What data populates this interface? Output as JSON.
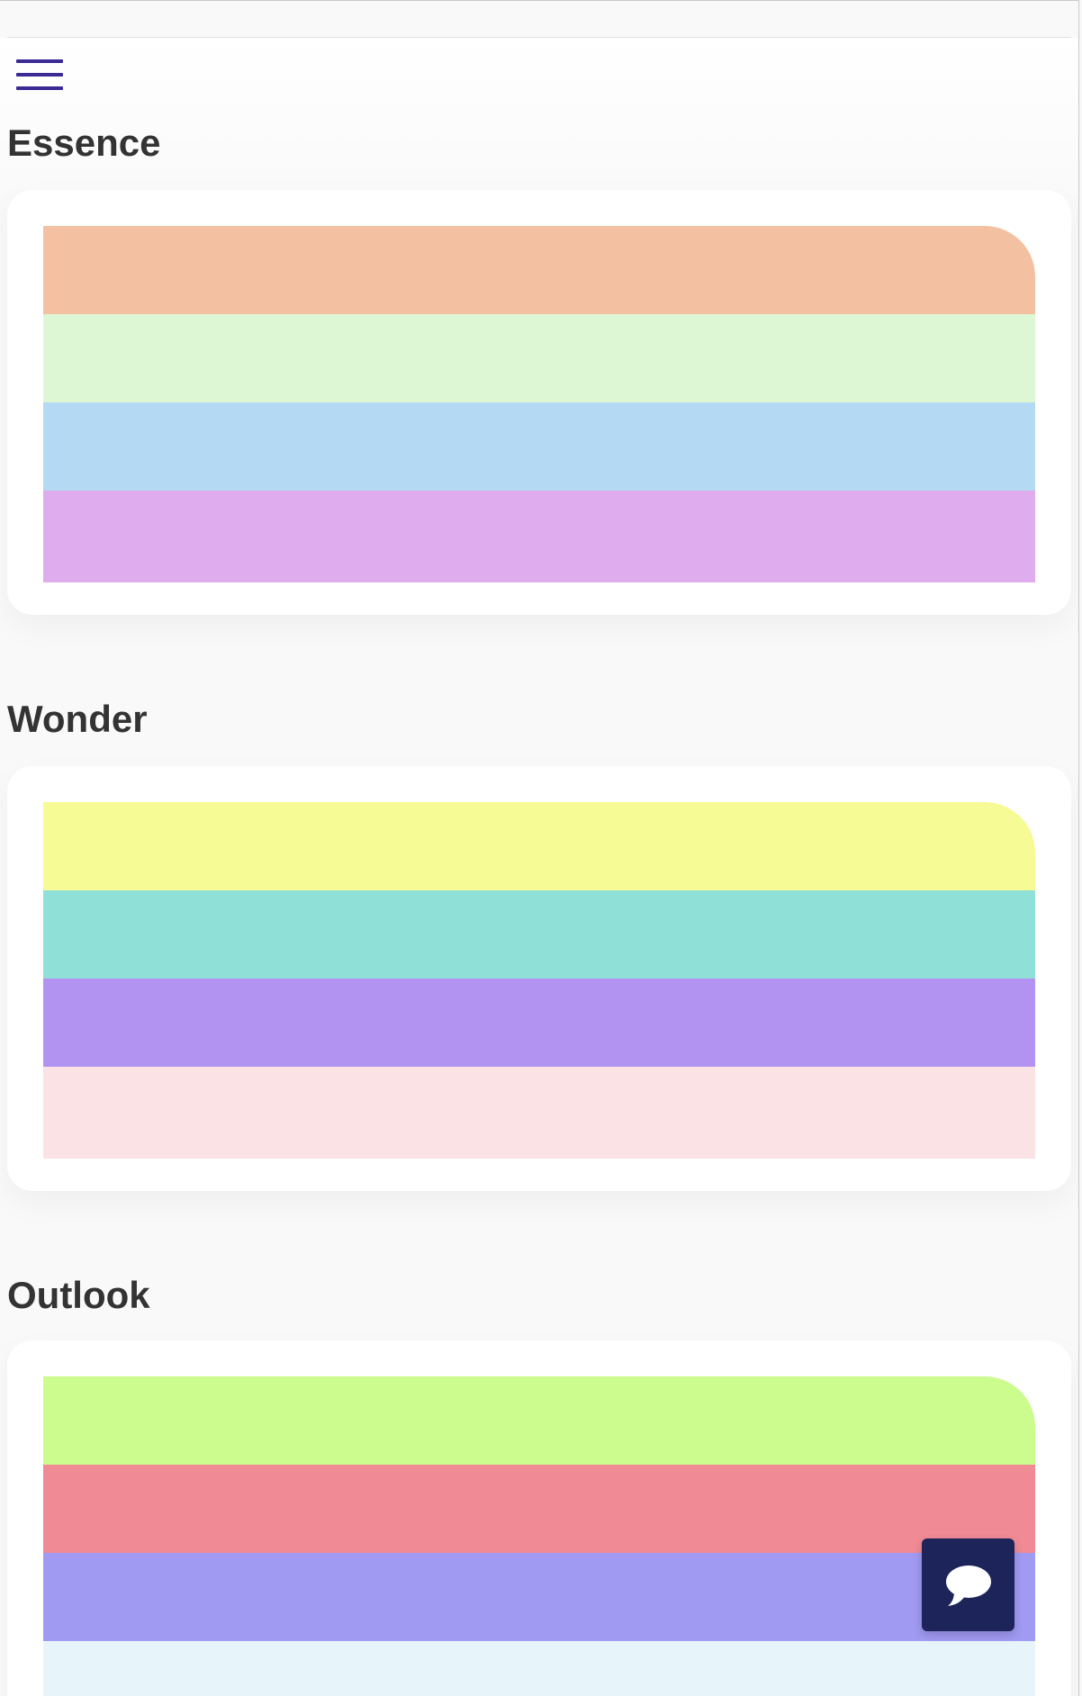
{
  "nav": {
    "menu_icon": "hamburger-menu-icon",
    "accent_color": "#3b2a96"
  },
  "palettes": [
    {
      "title": "Essence",
      "colors": [
        "#f3c1a1",
        "#ddf7d4",
        "#b4daf3",
        "#dfaced"
      ]
    },
    {
      "title": "Wonder",
      "colors": [
        "#f7fb96",
        "#8fe1d8",
        "#b293f2",
        "#fbe3e5"
      ]
    },
    {
      "title": "Outlook",
      "colors": [
        "#cbfc8d",
        "#f08a95",
        "#a09af2",
        "#e7f5fb"
      ]
    }
  ],
  "chat": {
    "icon": "chat-bubble-icon",
    "background_color": "#1c2459"
  }
}
